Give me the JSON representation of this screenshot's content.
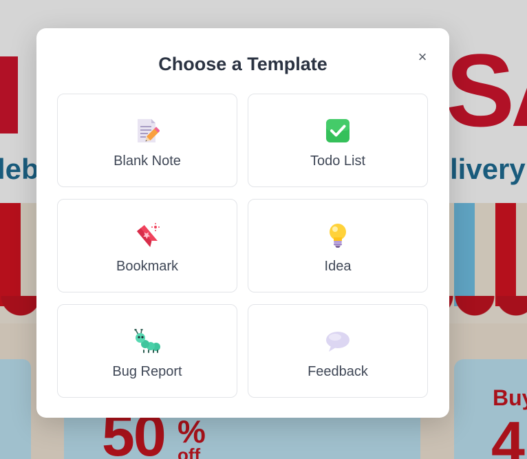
{
  "background": {
    "hero_right_text": "SA",
    "sub_left_text": "leb",
    "sub_right_text": "livery",
    "promo_big": "50",
    "promo_percent": "%",
    "promo_off": "off",
    "right_buy": "Buy",
    "right_number": "4"
  },
  "modal": {
    "title": "Choose a Template",
    "close_label": "×",
    "templates": [
      {
        "label": "Blank Note",
        "icon": "memo-icon"
      },
      {
        "label": "Todo List",
        "icon": "check-box-icon"
      },
      {
        "label": "Bookmark",
        "icon": "bookmark-icon"
      },
      {
        "label": "Idea",
        "icon": "light-bulb-icon"
      },
      {
        "label": "Bug Report",
        "icon": "bug-icon"
      },
      {
        "label": "Feedback",
        "icon": "speech-balloon-icon"
      }
    ]
  },
  "colors": {
    "title": "#2b3342",
    "label": "#3f4756",
    "tile_border": "#e2e4e8",
    "promo_red": "#c9101c",
    "promo_blue": "#1a6b93",
    "check_green": "#35c05a",
    "bookmark_pink": "#f0425c",
    "bulb_yellow": "#ffd23a",
    "bug_green": "#3fc59d",
    "balloon_lilac": "#dcd6f2"
  }
}
